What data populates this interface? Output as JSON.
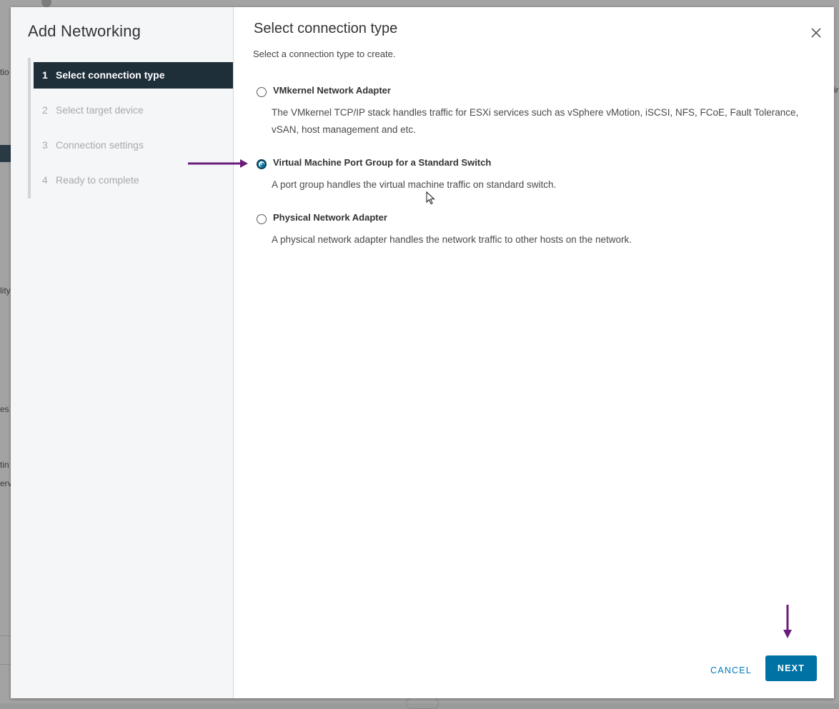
{
  "background": {
    "fragments": [
      "tio",
      "lity",
      "es",
      "tin",
      "erv",
      "ir"
    ]
  },
  "modal": {
    "title": "Add Networking",
    "steps": [
      {
        "number": "1",
        "label": "Select connection type",
        "active": true
      },
      {
        "number": "2",
        "label": "Select target device",
        "active": false
      },
      {
        "number": "3",
        "label": "Connection settings",
        "active": false
      },
      {
        "number": "4",
        "label": "Ready to complete",
        "active": false
      }
    ],
    "content": {
      "title": "Select connection type",
      "subtitle": "Select a connection type to create.",
      "options": [
        {
          "label": "VMkernel Network Adapter",
          "description": "The VMkernel TCP/IP stack handles traffic for ESXi services such as vSphere vMotion, iSCSI, NFS, FCoE, Fault Tolerance, vSAN, host management and etc.",
          "selected": false
        },
        {
          "label": "Virtual Machine Port Group for a Standard Switch",
          "description": "A port group handles the virtual machine traffic on standard switch.",
          "selected": true
        },
        {
          "label": "Physical Network Adapter",
          "description": "A physical network adapter handles the network traffic to other hosts on the network.",
          "selected": false
        }
      ]
    },
    "buttons": {
      "cancel": "CANCEL",
      "next": "NEXT"
    }
  },
  "colors": {
    "accent": "#0072a3",
    "active_step_bg": "#1f2f3a",
    "annotation_arrow": "#6a1b7a"
  },
  "icons": {
    "close": "close-icon",
    "pointer": "mouse-pointer-icon",
    "annotation": "arrow-annotation-icon"
  }
}
